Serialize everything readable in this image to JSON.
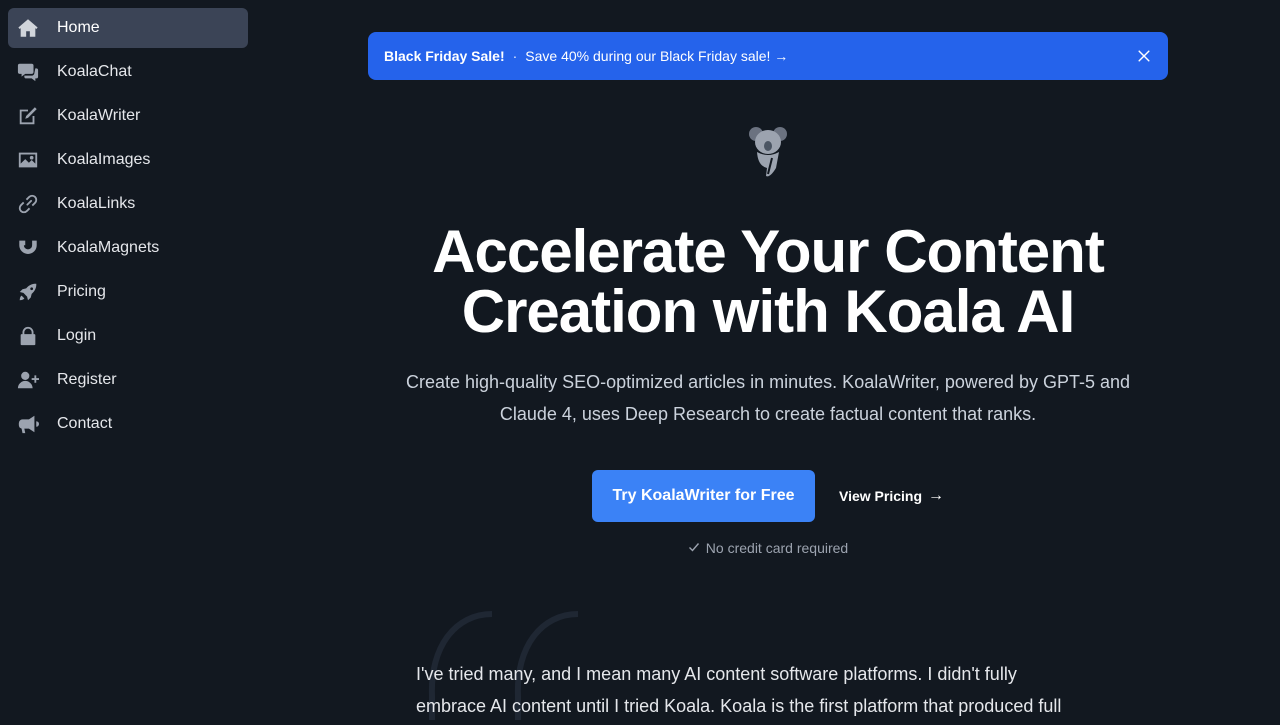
{
  "sidebar": {
    "items": [
      {
        "label": "Home",
        "icon": "home-icon",
        "active": true
      },
      {
        "label": "KoalaChat",
        "icon": "chat-icon"
      },
      {
        "label": "KoalaWriter",
        "icon": "pencil-square-icon"
      },
      {
        "label": "KoalaImages",
        "icon": "image-icon"
      },
      {
        "label": "KoalaLinks",
        "icon": "link-icon"
      },
      {
        "label": "KoalaMagnets",
        "icon": "magnet-icon"
      },
      {
        "label": "Pricing",
        "icon": "rocket-icon"
      },
      {
        "label": "Login",
        "icon": "lock-icon"
      },
      {
        "label": "Register",
        "icon": "user-plus-icon"
      },
      {
        "label": "Contact",
        "icon": "megaphone-icon"
      }
    ]
  },
  "banner": {
    "title": "Black Friday Sale!",
    "separator": "·",
    "message": "Save 40% during our Black Friday sale! →",
    "close_icon": "close-icon"
  },
  "hero": {
    "logo_icon": "koala-logo-icon",
    "headline_line1": "Accelerate Your Content",
    "headline_line2": "Creation with Koala AI",
    "subtext_line1": "Create high-quality SEO-optimized articles in minutes. KoalaWriter, powered by GPT-5 and",
    "subtext_line2": "Claude 4, uses Deep Research to create factual content that ranks.",
    "primary_cta": "Try KoalaWriter for Free",
    "secondary_cta": "View Pricing",
    "secondary_cta_arrow": "→",
    "note": "No credit card required"
  },
  "testimonial": {
    "line1": "I've tried many, and I mean many AI content software platforms. I didn't fully",
    "line2": "embrace AI content until I tried Koala. Koala is the first platform that produced full"
  },
  "colors": {
    "background": "#121820",
    "accent": "#2563eb",
    "button": "#3b82f6",
    "active_nav": "#3b4456"
  }
}
